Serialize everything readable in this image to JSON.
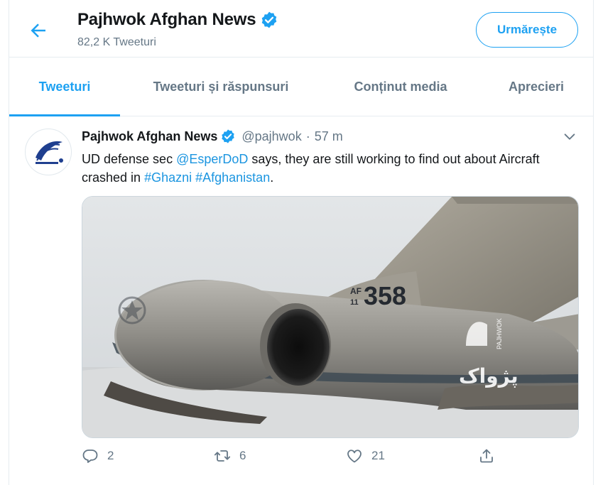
{
  "header": {
    "title": "Pajhwok Afghan News",
    "tweet_count": "82,2 K Tweeturi",
    "follow_label": "Urmărește"
  },
  "tabs": [
    {
      "label": "Tweeturi",
      "active": true
    },
    {
      "label": "Tweeturi și răspunsuri",
      "active": false
    },
    {
      "label": "Conținut media",
      "active": false
    },
    {
      "label": "Aprecieri",
      "active": false
    }
  ],
  "tweet": {
    "name": "Pajhwok Afghan News",
    "handle": "@pajhwok",
    "separator": "·",
    "time": "57 m",
    "text_part1": "UD defense sec ",
    "mention": "@EsperDoD",
    "text_part2": " says, they are still working to find out about Aircraft crashed in ",
    "hashtag1": "#Ghazni",
    "space": " ",
    "hashtag2": "#Afghanistan",
    "text_end": ".",
    "media": {
      "tail_prefix": "AF",
      "tail_year": "11",
      "tail_number": "358",
      "watermark": "PAJHWOK",
      "watermark_script": "پژواک"
    },
    "actions": {
      "reply_count": "2",
      "retweet_count": "6",
      "like_count": "21"
    }
  },
  "colors": {
    "accent": "#1da1f2",
    "link": "#1b95e0",
    "secondary_text": "#657786",
    "border": "#e6ecf0"
  },
  "icons": [
    "back-arrow-icon",
    "verified-badge-icon",
    "chevron-down-icon",
    "reply-icon",
    "retweet-icon",
    "like-icon",
    "share-icon"
  ]
}
